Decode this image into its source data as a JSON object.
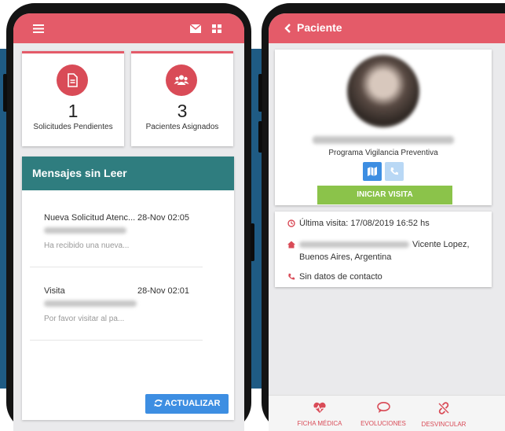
{
  "colors": {
    "accent": "#e45b69",
    "header_teal": "#2f7d7f",
    "button_blue": "#3d8ee2",
    "button_green": "#8bc34a",
    "background_blue": "#1f5b84"
  },
  "left_screen": {
    "topbar": {
      "icons": [
        "menu-icon",
        "mail-icon",
        "grid-icon"
      ]
    },
    "stats": [
      {
        "icon": "document-icon",
        "value": "1",
        "label": "Solicitudes Pendientes"
      },
      {
        "icon": "users-icon",
        "value": "3",
        "label": "Pacientes Asignados"
      }
    ],
    "messages": {
      "header": "Mensajes sin Leer",
      "items": [
        {
          "title": "Nueva Solicitud Atenc...",
          "date": "28-Nov 02:05",
          "preview": "Ha recibido una nueva..."
        },
        {
          "title": "Visita",
          "date": "28-Nov 02:01",
          "preview": "Por favor visitar al pa..."
        }
      ],
      "refresh_label": "ACTUALIZAR"
    }
  },
  "right_screen": {
    "title": "Paciente",
    "program": "Programa Vigilancia Preventiva",
    "start_visit": "INICIAR VISITA",
    "last_visit": "Última visita: 17/08/2019 16:52 hs",
    "address_visible": "Vicente Lopez,",
    "address_line2": "Buenos Aires, Argentina",
    "contact": "Sin datos de contacto",
    "nav": [
      {
        "icon": "heart-pulse-icon",
        "label": "FICHA MÉDICA"
      },
      {
        "icon": "chat-icon",
        "label": "EVOLUCIONES"
      },
      {
        "icon": "unlink-icon",
        "label": "DESVINCULAR"
      }
    ]
  }
}
